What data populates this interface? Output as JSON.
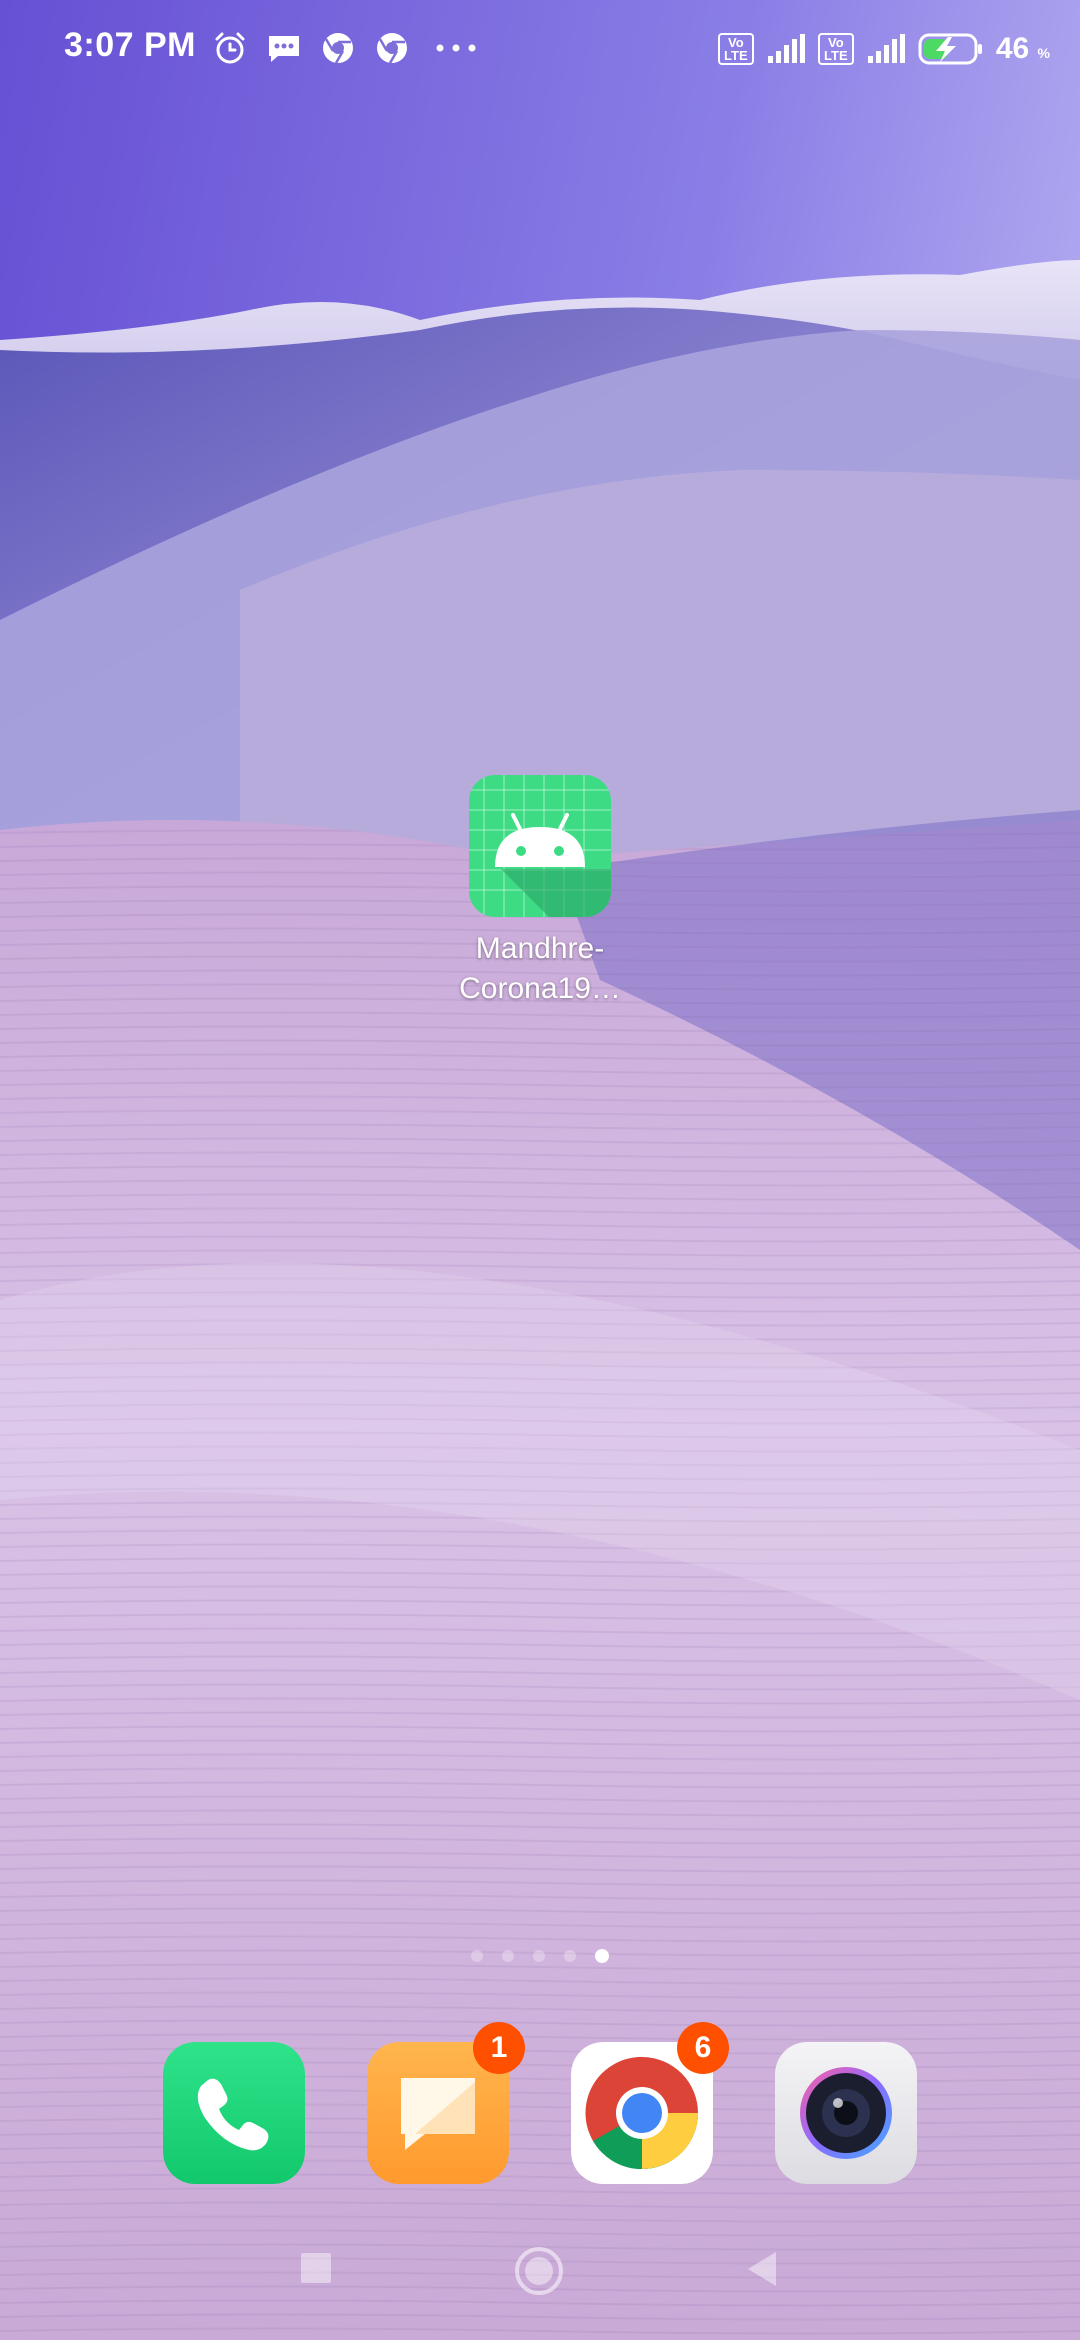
{
  "status_bar": {
    "time": "3:07 PM",
    "notification_icons": [
      "alarm-icon",
      "message-icon",
      "chrome-icon",
      "chrome-icon",
      "more-icon"
    ],
    "volte_1": "Vo LTE",
    "volte_2": "Vo LTE",
    "battery_percent": "46",
    "battery_unit": "%"
  },
  "home": {
    "apps": [
      {
        "label": "Mandhre-\nCorona19…",
        "label_line1": "Mandhre-",
        "label_line2": "Corona19…",
        "icon": "android-icon",
        "color": "#3ddc84"
      }
    ]
  },
  "pages": {
    "count": 5,
    "active": 5
  },
  "dock": {
    "apps": [
      {
        "name": "Phone",
        "icon": "phone-icon",
        "color": "#1fd67a"
      },
      {
        "name": "Messages",
        "icon": "messages-icon",
        "color": "#ffa53a",
        "badge": "1"
      },
      {
        "name": "Chrome",
        "icon": "chrome-icon",
        "badge": "6"
      },
      {
        "name": "Camera",
        "icon": "camera-icon"
      }
    ]
  },
  "nav_bar": {
    "buttons": [
      "recents-icon",
      "home-icon",
      "back-icon"
    ]
  },
  "colors": {
    "badge": "#ff5000",
    "sky_top": "#6a55d6",
    "dune": "#b8a4d6"
  }
}
